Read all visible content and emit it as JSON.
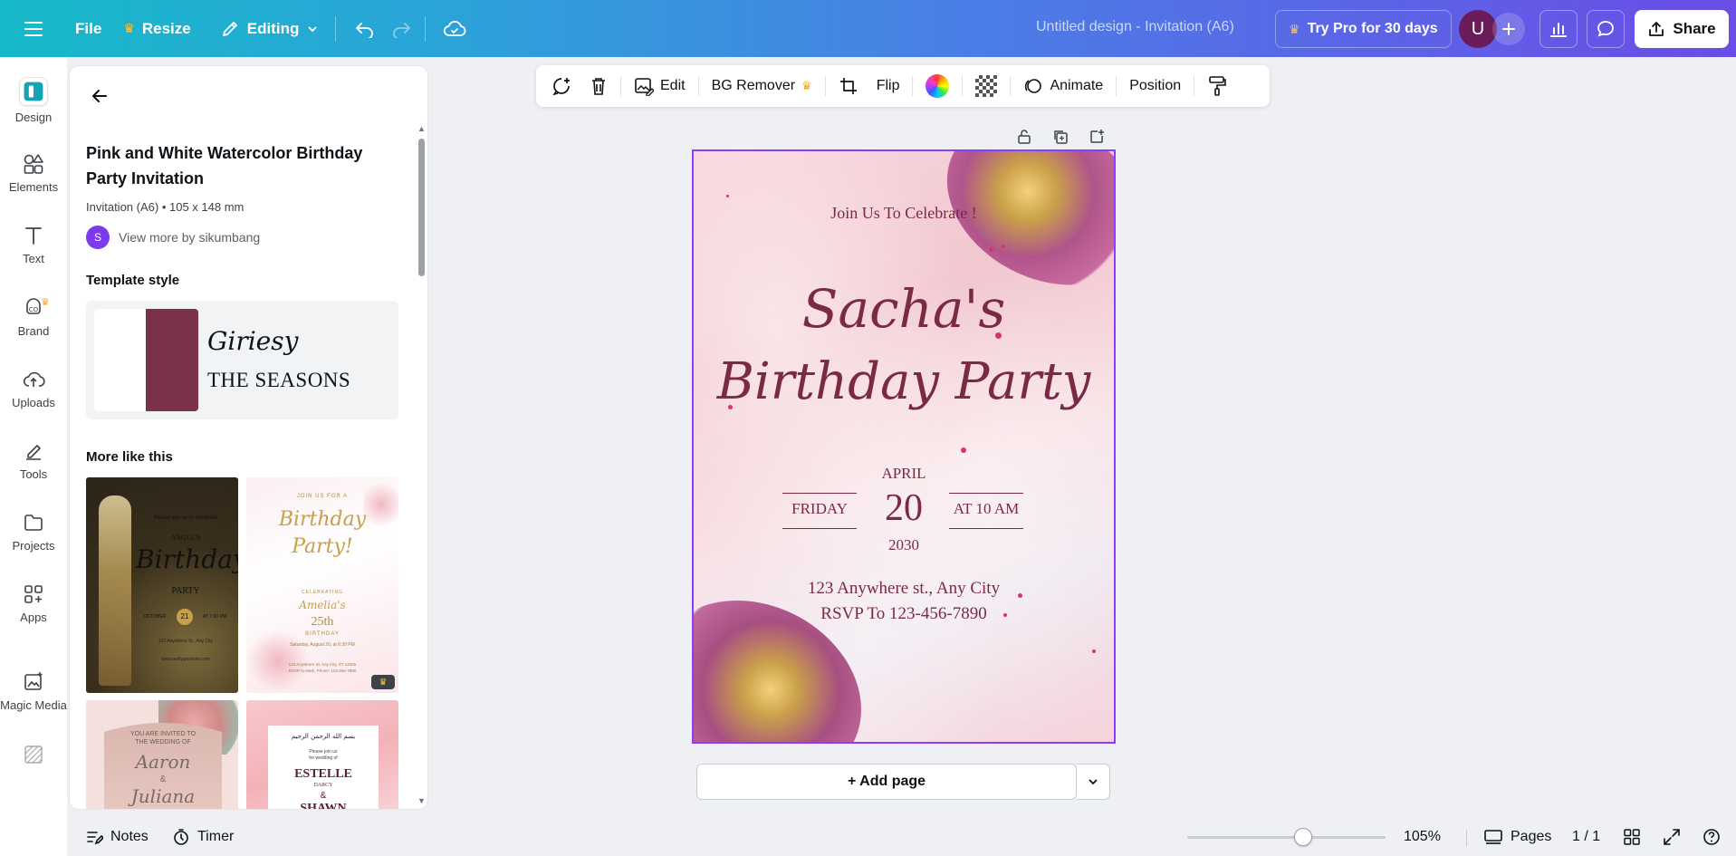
{
  "topbar": {
    "file_label": "File",
    "resize_label": "Resize",
    "editing_label": "Editing",
    "doc_title": "Untitled design - Invitation (A6)",
    "try_pro_label": "Try Pro for 30 days",
    "avatar_initial": "U",
    "share_label": "Share"
  },
  "rail": {
    "items": [
      {
        "label": "Design"
      },
      {
        "label": "Elements"
      },
      {
        "label": "Text"
      },
      {
        "label": "Brand"
      },
      {
        "label": "Uploads"
      },
      {
        "label": "Tools"
      },
      {
        "label": "Projects"
      },
      {
        "label": "Apps"
      },
      {
        "label": "Magic Media"
      }
    ]
  },
  "panel": {
    "title": "Pink and White Watercolor Birthday Party Invitation",
    "meta": "Invitation (A6) • 105 x 148 mm",
    "author_initial": "S",
    "author_link": "View more by sikumbang",
    "template_style_heading": "Template style",
    "font_script_sample": "Giriesy",
    "font_serif_sample": "THE SEASONS",
    "palette": [
      "#ffffff",
      "#7a3248"
    ],
    "more_heading": "More like this",
    "thumbs": [
      {
        "lines": [
          "Please join us to celebrate",
          "ANGEL'S",
          "Birthday",
          "PARTY",
          "OCTOBER",
          "21",
          "AT 7:00 PM",
          "123 Anywhere St., Any City",
          "www.reallygreatsite.com"
        ]
      },
      {
        "lines": [
          "JOIN US FOR A",
          "Birthday",
          "Party!",
          "CELEBRATING",
          "Amelia's",
          "25th",
          "BIRTHDAY",
          "Saturday, August 20, at 6:30 PM",
          "123 Anywhere St, Any City, ST 12345",
          "RSVP to Mark, Phone: 123-456-7890"
        ]
      },
      {
        "lines": [
          "YOU ARE INVITED TO",
          "THE WEDDING OF",
          "Aaron",
          "&",
          "Juliana"
        ]
      },
      {
        "lines": [
          "بسم الله الرحمن الرحيم",
          "Please join us",
          "for wedding of",
          "ESTELLE",
          "DARCY",
          "&",
          "SHAWN"
        ]
      }
    ]
  },
  "context_bar": {
    "edit_label": "Edit",
    "bg_remover_label": "BG Remover",
    "flip_label": "Flip",
    "animate_label": "Animate",
    "position_label": "Position"
  },
  "design": {
    "join_text": "Join Us To Celebrate !",
    "name_text": "Sacha's",
    "party_text": "Birthday Party",
    "month": "APRIL",
    "weekday": "FRIDAY",
    "day": "20",
    "time": "AT 10 AM",
    "year": "2030",
    "address": "123 Anywhere st., Any City",
    "rsvp": "RSVP To 123-456-7890"
  },
  "canvas": {
    "add_page_label": "+ Add page"
  },
  "bottombar": {
    "notes_label": "Notes",
    "timer_label": "Timer",
    "zoom_value": "105%",
    "pages_label": "Pages",
    "page_count": "1 / 1"
  }
}
